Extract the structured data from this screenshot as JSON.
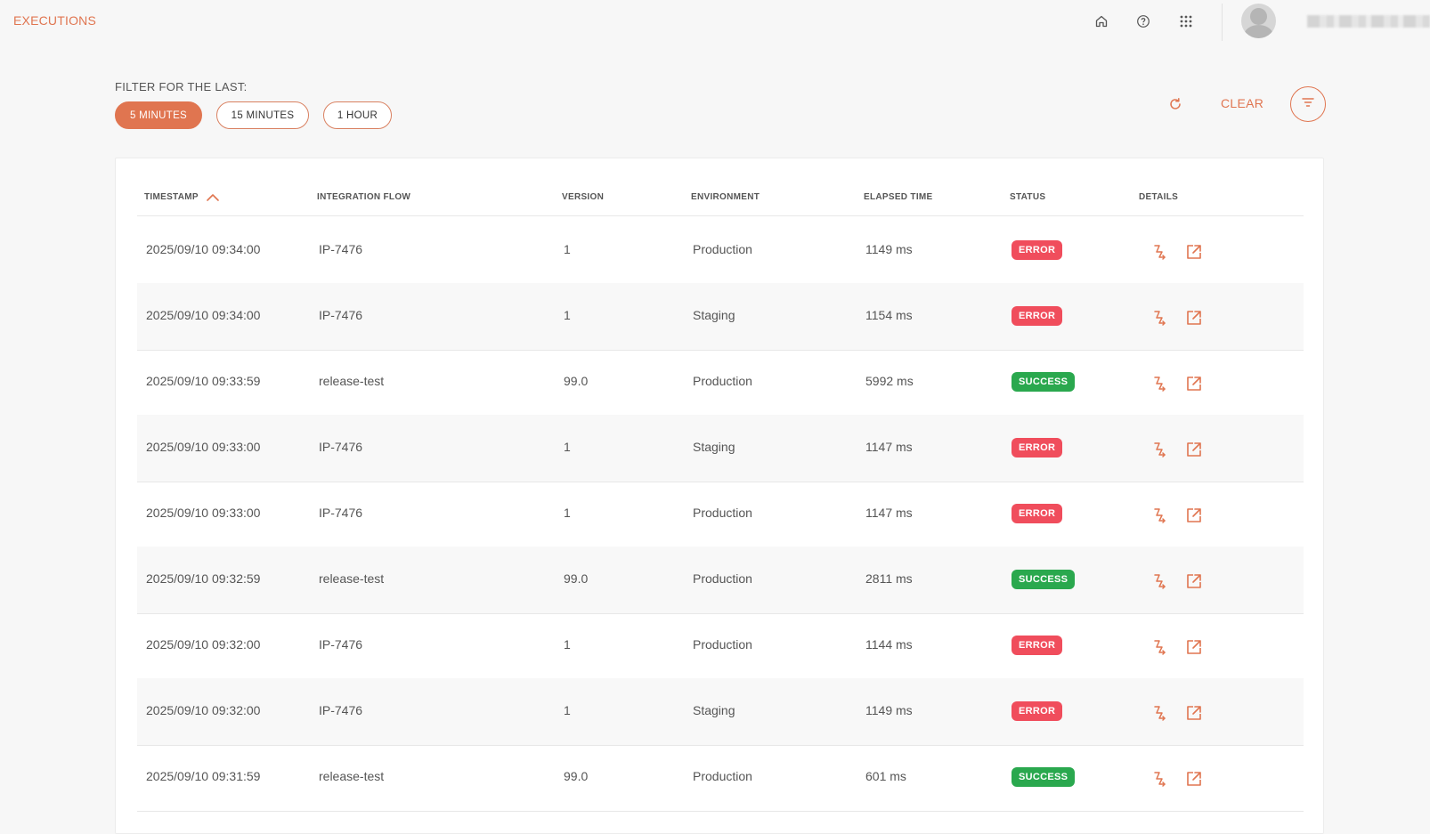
{
  "app": {
    "title": "EXECUTIONS"
  },
  "header": {
    "icons": [
      "home-icon",
      "help-icon",
      "apps-grid-icon"
    ],
    "user_name": ""
  },
  "filter": {
    "label": "FILTER FOR THE LAST:",
    "options": [
      "5 MINUTES",
      "15 MINUTES",
      "1 HOUR"
    ],
    "selected": "5 MINUTES",
    "clear_label": "CLEAR"
  },
  "colors": {
    "accent": "#e07550",
    "error": "#f04d5c",
    "success": "#2aa84e"
  },
  "table": {
    "columns": [
      "TIMESTAMP",
      "INTEGRATION FLOW",
      "VERSION",
      "ENVIRONMENT",
      "ELAPSED TIME",
      "STATUS",
      "DETAILS"
    ],
    "sort": {
      "column": "TIMESTAMP",
      "direction": "ascending"
    },
    "rows": [
      {
        "timestamp": "2025/09/10 09:34:00",
        "flow": "IP-7476",
        "version": "1",
        "environment": "Production",
        "elapsed": "1149 ms",
        "status": "ERROR"
      },
      {
        "timestamp": "2025/09/10 09:34:00",
        "flow": "IP-7476",
        "version": "1",
        "environment": "Staging",
        "elapsed": "1154 ms",
        "status": "ERROR"
      },
      {
        "timestamp": "2025/09/10 09:33:59",
        "flow": "release-test",
        "version": "99.0",
        "environment": "Production",
        "elapsed": "5992 ms",
        "status": "SUCCESS"
      },
      {
        "timestamp": "2025/09/10 09:33:00",
        "flow": "IP-7476",
        "version": "1",
        "environment": "Staging",
        "elapsed": "1147 ms",
        "status": "ERROR"
      },
      {
        "timestamp": "2025/09/10 09:33:00",
        "flow": "IP-7476",
        "version": "1",
        "environment": "Production",
        "elapsed": "1147 ms",
        "status": "ERROR"
      },
      {
        "timestamp": "2025/09/10 09:32:59",
        "flow": "release-test",
        "version": "99.0",
        "environment": "Production",
        "elapsed": "2811 ms",
        "status": "SUCCESS"
      },
      {
        "timestamp": "2025/09/10 09:32:00",
        "flow": "IP-7476",
        "version": "1",
        "environment": "Production",
        "elapsed": "1144 ms",
        "status": "ERROR"
      },
      {
        "timestamp": "2025/09/10 09:32:00",
        "flow": "IP-7476",
        "version": "1",
        "environment": "Staging",
        "elapsed": "1149 ms",
        "status": "ERROR"
      },
      {
        "timestamp": "2025/09/10 09:31:59",
        "flow": "release-test",
        "version": "99.0",
        "environment": "Production",
        "elapsed": "601 ms",
        "status": "SUCCESS"
      }
    ]
  }
}
